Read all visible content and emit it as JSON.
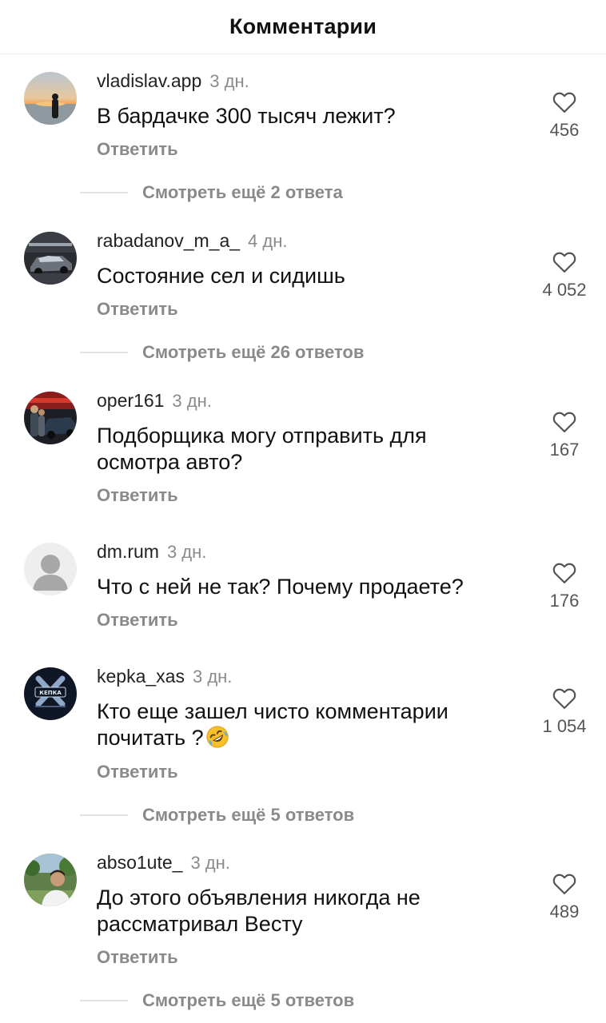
{
  "header": {
    "title": "Комментарии"
  },
  "reply_label": "Ответить",
  "comments": [
    {
      "username": "vladislav.app",
      "time": "3 дн.",
      "text": "В бардачке 300 тысяч лежит?",
      "likes": "456",
      "more": "Смотреть ещё 2 ответа",
      "avatar": "sunset-beach-photo"
    },
    {
      "username": "rabadanov_m_a_",
      "time": "4 дн.",
      "text": "Состояние сел и сидишь",
      "likes": "4 052",
      "more": "Смотреть ещё 26 ответов",
      "avatar": "car-photo"
    },
    {
      "username": "oper161",
      "time": "3 дн.",
      "text": "Подборщика могу отправить для осмотра авто?",
      "likes": "167",
      "more": "",
      "avatar": "people-with-car-photo"
    },
    {
      "username": "dm.rum",
      "time": "3 дн.",
      "text": "Что с ней не так? Почему продаете?",
      "likes": "176",
      "more": "",
      "avatar": "default-user-icon"
    },
    {
      "username": "kepka_xas",
      "time": "3 дн.",
      "text": "Кто еще зашел чисто комментарии почитать ?",
      "emoji": "rolling-on-floor-laughing-emoji",
      "likes": "1 054",
      "more": "Смотреть ещё 5 ответов",
      "avatar": "kepka-logo",
      "avatar_logo_text": "КЕПКА"
    },
    {
      "username": "abso1ute_",
      "time": "3 дн.",
      "text": "До этого объявления никогда не рассматривал Весту",
      "likes": "489",
      "more": "Смотреть ещё 5 ответов",
      "avatar": "person-outdoor-photo"
    }
  ]
}
